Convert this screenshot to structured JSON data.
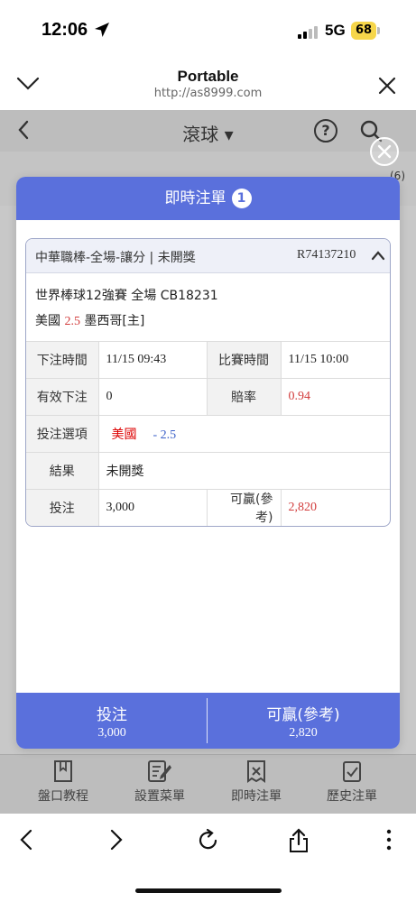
{
  "status_bar": {
    "time": "12:06",
    "network": "5G",
    "battery": "68"
  },
  "browser": {
    "title": "Portable",
    "url": "http://as8999.com"
  },
  "app": {
    "title": "滾球 ▾",
    "help_glyph": "?",
    "bg_count": "(6)"
  },
  "overlay": {
    "close_glyph": "✕"
  },
  "modal": {
    "header": "即時注單",
    "badge": "1",
    "ticket": {
      "league": "中華職棒-全場-讓分 | 未開獎",
      "ref": "R74137210",
      "match": "世界棒球12強賽 全場 CB18231",
      "team_home": "美國",
      "handicap": "2.5",
      "team_away": "墨西哥[主]",
      "rows": {
        "bet_time_label": "下注時間",
        "bet_time": "11/15 09:43",
        "match_time_label": "比賽時間",
        "match_time": "11/15 10:00",
        "valid_label": "有效下注",
        "valid": "0",
        "odds_label": "賠率",
        "odds": "0.94",
        "option_label": "投注選項",
        "option_team": "美國",
        "option_hcp": "- 2.5",
        "result_label": "結果",
        "result": "未開獎",
        "stake_label": "投注",
        "stake": "3,000",
        "win_label": "可贏(參考)",
        "win": "2,820"
      }
    },
    "footer": {
      "stake_label": "投注",
      "stake": "3,000",
      "win_label": "可贏(參考)",
      "win": "2,820"
    }
  },
  "bottom_nav": [
    {
      "label": "盤口教程",
      "icon": "book-icon"
    },
    {
      "label": "設置菜單",
      "icon": "edit-list-icon"
    },
    {
      "label": "即時注單",
      "icon": "live-bet-icon"
    },
    {
      "label": "歷史注單",
      "icon": "history-icon"
    }
  ],
  "colors": {
    "accent": "#5a70dc",
    "red": "#d23c3c",
    "blue": "#3a5fc8",
    "battery": "#f6d64a"
  }
}
